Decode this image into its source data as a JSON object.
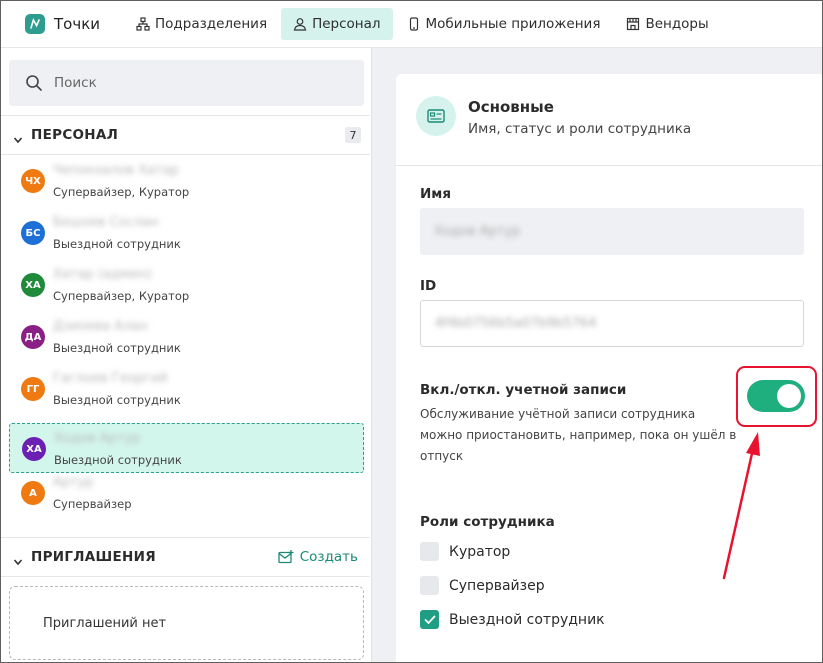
{
  "app": {
    "name": "Точки"
  },
  "nav": {
    "tabs": [
      {
        "label": "Подразделения",
        "icon": "org-structure-icon",
        "active": false
      },
      {
        "label": "Персонал",
        "icon": "person-icon",
        "active": true
      },
      {
        "label": "Мобильные приложения",
        "icon": "mobile-icon",
        "active": false
      },
      {
        "label": "Вендоры",
        "icon": "store-icon",
        "active": false
      }
    ]
  },
  "sidebar": {
    "search": {
      "placeholder": "Поиск"
    },
    "staff_section": {
      "title": "ПЕРСОНАЛ",
      "count": "7"
    },
    "staff": [
      {
        "initials": "ЧХ",
        "name": "Чепокоалов Хатар",
        "role": "Супервайзер, Куратор",
        "color": "#f07a12",
        "selected": false
      },
      {
        "initials": "БС",
        "name": "Бешоев Сослан",
        "role": "Выездной сотрудник",
        "color": "#1e6fd6",
        "selected": false
      },
      {
        "initials": "ХА",
        "name": "Хатар (админ)",
        "role": "Супервайзер, Куратор",
        "color": "#1f8a3a",
        "selected": false
      },
      {
        "initials": "ДА",
        "name": "Дзиоевa Алан",
        "role": "Выездной сотрудник",
        "color": "#8a1f86",
        "selected": false
      },
      {
        "initials": "ГГ",
        "name": "Гаглоев Георгий",
        "role": "Выездной сотрудник",
        "color": "#f07a12",
        "selected": false
      },
      {
        "initials": "ХА",
        "name": "Ходов Артур",
        "role": "Выездной сотрудник",
        "color": "#6b1fb3",
        "selected": true
      },
      {
        "initials": "А",
        "name": "Артур",
        "role": "Супервайзер",
        "color": "#f07a12",
        "selected": false
      }
    ],
    "invites_section": {
      "title": "ПРИГЛАШЕНИЯ",
      "create_label": "Создать",
      "empty_text": "Приглашений нет"
    }
  },
  "card": {
    "title": "Основные",
    "subtitle": "Имя, статус и роли сотрудника",
    "name_label": "Имя",
    "name_value": "Ходов Артур",
    "id_label": "ID",
    "id_value": "4f4b0756b5a07b9b5764",
    "toggle_title": "Вкл./откл. учетной записи",
    "toggle_desc": "Обслуживание учётной записи сотрудника можно приостановить, например, пока он ушёл в отпуск",
    "toggle_on": true,
    "roles_title": "Роли сотрудника",
    "roles": [
      {
        "label": "Куратор",
        "checked": false
      },
      {
        "label": "Супервайзер",
        "checked": false
      },
      {
        "label": "Выездной сотрудник",
        "checked": true
      }
    ]
  },
  "colors": {
    "accent": "#1f9e83",
    "active_tab_bg": "#d5f3ec",
    "highlight": "#e8132e",
    "toggle_on": "#1fae7e"
  }
}
